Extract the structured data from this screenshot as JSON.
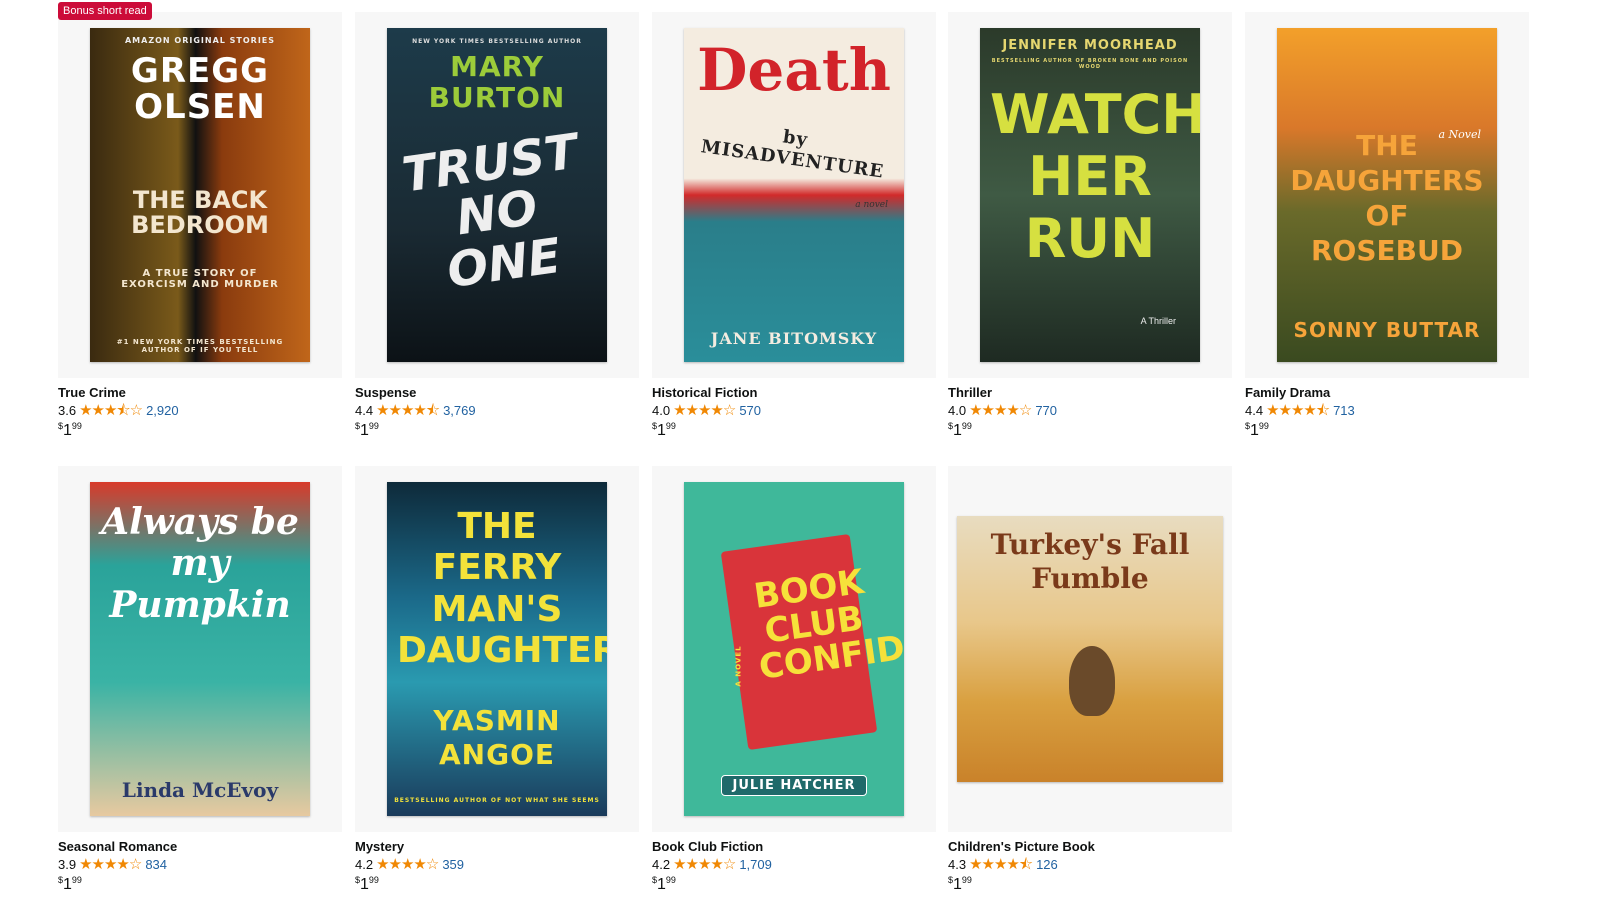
{
  "badge": "Bonus short read",
  "books": [
    {
      "genre": "True Crime",
      "rating": "3.6",
      "stars": "★★★⯪☆",
      "count": "2,920",
      "price": {
        "symbol": "$",
        "whole": "1",
        "fraction": "99"
      },
      "cover": {
        "top": "AMAZON ORIGINAL STORIES",
        "author": "GREGG OLSEN",
        "title": "THE BACK BEDROOM",
        "subtitle": "A TRUE STORY OF EXORCISM AND MURDER",
        "bottom": "#1 NEW YORK TIMES BESTSELLING AUTHOR OF IF YOU TELL"
      }
    },
    {
      "genre": "Suspense",
      "rating": "4.4",
      "stars": "★★★★⯪",
      "count": "3,769",
      "price": {
        "symbol": "$",
        "whole": "1",
        "fraction": "99"
      },
      "cover": {
        "top": "NEW YORK TIMES BESTSELLING AUTHOR",
        "author": "MARY BURTON",
        "title": "TRUST NO ONE"
      }
    },
    {
      "genre": "Historical Fiction",
      "rating": "4.0",
      "stars": "★★★★☆",
      "count": "570",
      "price": {
        "symbol": "$",
        "whole": "1",
        "fraction": "99"
      },
      "cover": {
        "title": "Death",
        "subtitle": "by MISADVENTURE",
        "novel": "a novel",
        "author": "JANE BITOMSKY"
      }
    },
    {
      "genre": "Thriller",
      "rating": "4.0",
      "stars": "★★★★☆",
      "count": "770",
      "price": {
        "symbol": "$",
        "whole": "1",
        "fraction": "99"
      },
      "cover": {
        "author": "JENNIFER MOORHEAD",
        "top": "BESTSELLING AUTHOR OF BROKEN BONE AND POISON WOOD",
        "title": "WATCH HER RUN",
        "tag": "A Thriller"
      }
    },
    {
      "genre": "Family Drama",
      "rating": "4.4",
      "stars": "★★★★⯪",
      "count": "713",
      "price": {
        "symbol": "$",
        "whole": "1",
        "fraction": "99"
      },
      "cover": {
        "tag": "a Novel",
        "title": "THE DAUGHTERS OF ROSEBUD",
        "author": "SONNY BUTTAR"
      }
    },
    {
      "genre": "Seasonal Romance",
      "rating": "3.9",
      "stars": "★★★★☆",
      "count": "834",
      "price": {
        "symbol": "$",
        "whole": "1",
        "fraction": "99"
      },
      "cover": {
        "title": "Always be my Pumpkin",
        "author": "Linda McEvoy"
      }
    },
    {
      "genre": "Mystery",
      "rating": "4.2",
      "stars": "★★★★☆",
      "count": "359",
      "price": {
        "symbol": "$",
        "whole": "1",
        "fraction": "99"
      },
      "cover": {
        "title": "THE FERRY MAN'S DAUGHTER",
        "author": "YASMIN ANGOE",
        "bottom": "BESTSELLING AUTHOR OF NOT WHAT SHE SEEMS"
      }
    },
    {
      "genre": "Book Club Fiction",
      "rating": "4.2",
      "stars": "★★★★☆",
      "count": "1,709",
      "price": {
        "symbol": "$",
        "whole": "1",
        "fraction": "99"
      },
      "cover": {
        "title": "BOOK CLUB CONFIDENTIAL",
        "tag": "A NOVEL",
        "author": "JULIE HATCHER"
      }
    },
    {
      "genre": "Children's Picture Book",
      "rating": "4.3",
      "stars": "★★★★⯪",
      "count": "126",
      "price": {
        "symbol": "$",
        "whole": "1",
        "fraction": "99"
      },
      "cover": {
        "title": "Turkey's Fall Fumble"
      }
    }
  ],
  "colors": {
    "star": "#f08804",
    "link": "#2162a1",
    "badge": "#cc0c39"
  }
}
